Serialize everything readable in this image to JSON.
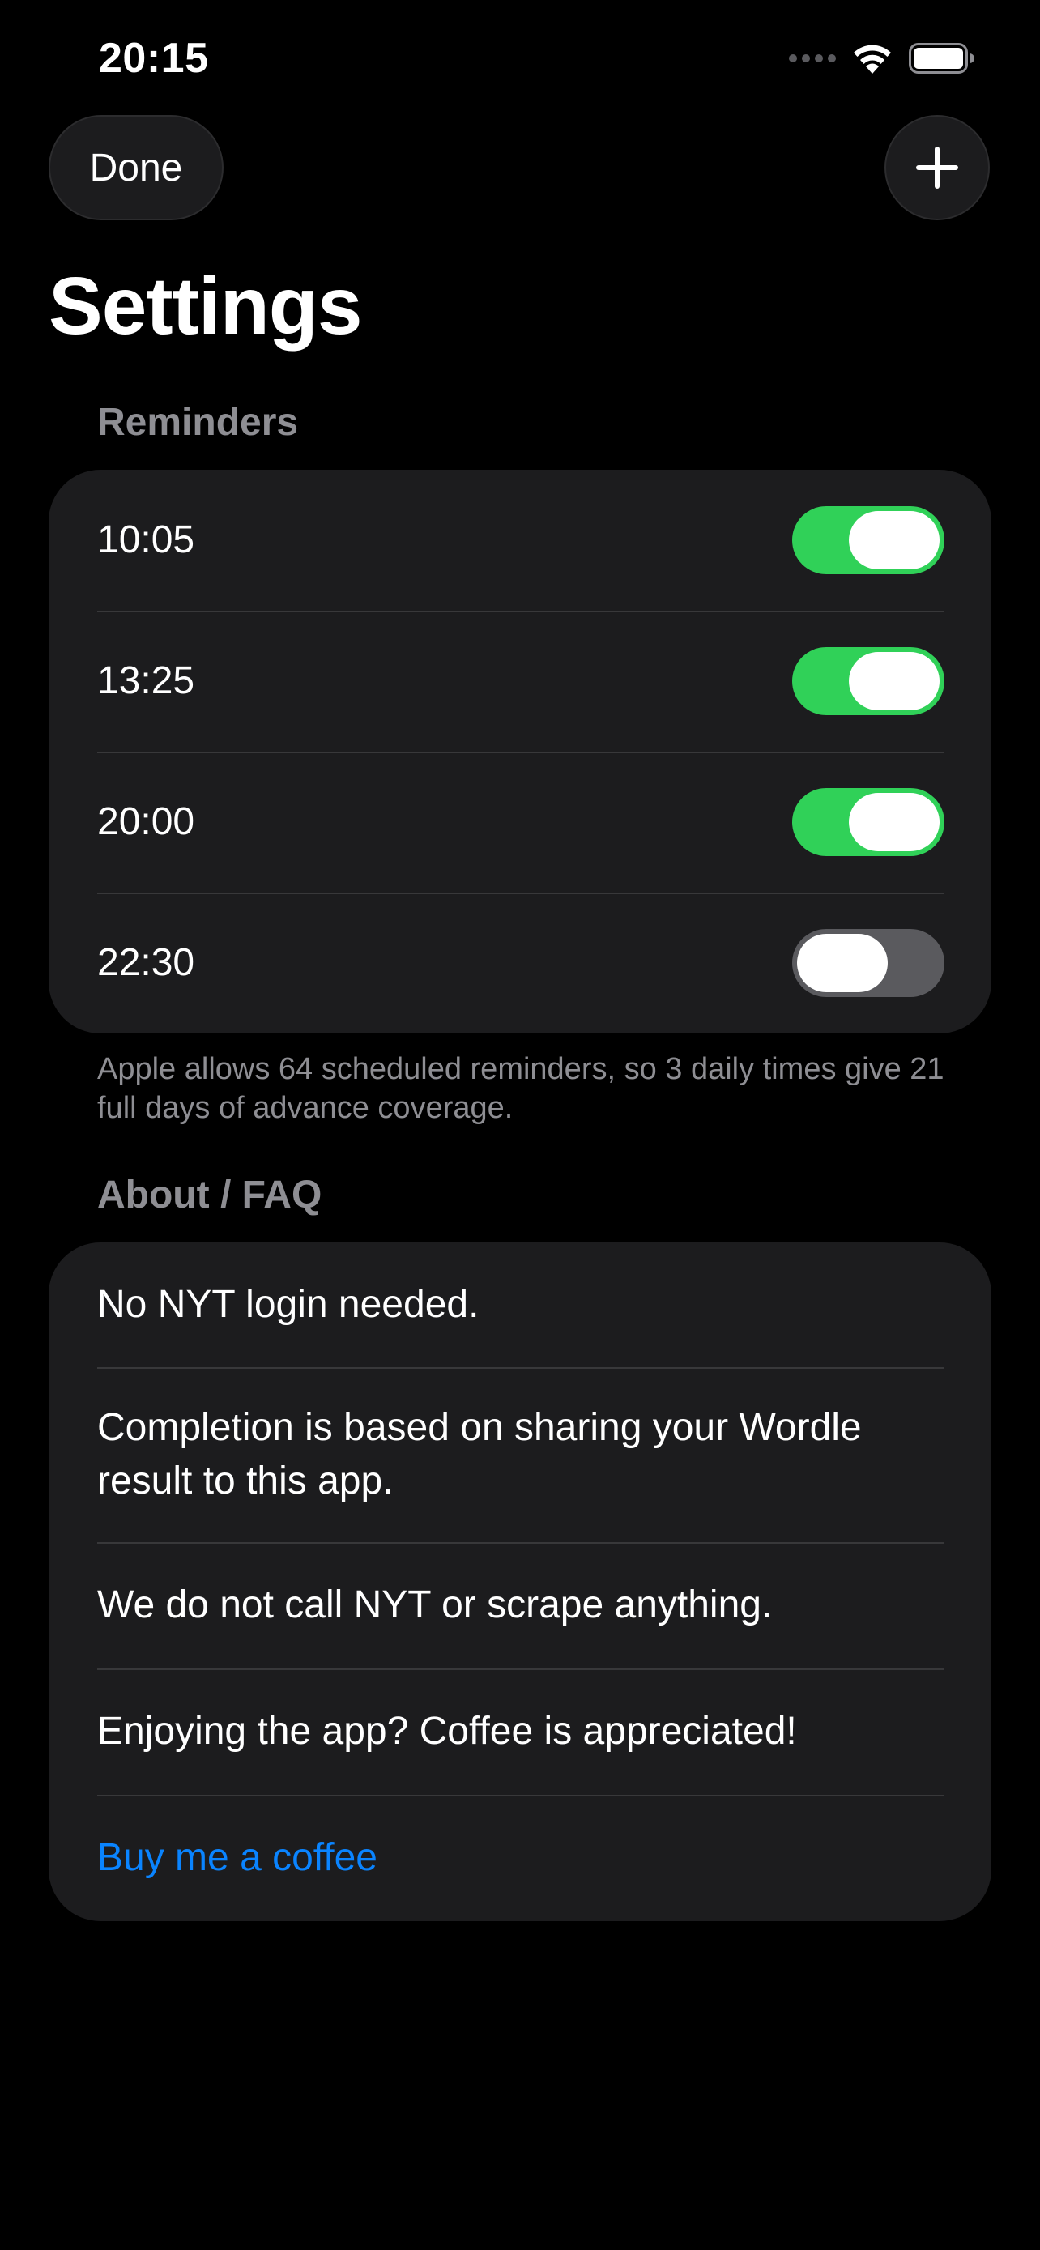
{
  "status_bar": {
    "time": "20:15"
  },
  "nav": {
    "done_label": "Done",
    "add_icon": "plus-icon"
  },
  "title": "Settings",
  "reminders": {
    "header": "Reminders",
    "items": [
      {
        "time": "10:05",
        "enabled": true
      },
      {
        "time": "13:25",
        "enabled": true
      },
      {
        "time": "20:00",
        "enabled": true
      },
      {
        "time": "22:30",
        "enabled": false
      }
    ],
    "footnote": "Apple allows 64 scheduled reminders, so 3 daily times give 21 full days of advance coverage."
  },
  "faq": {
    "header": "About / FAQ",
    "items": [
      "No NYT login needed.",
      "Completion is based on sharing your Wordle result to this app.",
      "We do not call NYT or scrape anything.",
      "Enjoying the app? Coffee is appreciated!"
    ],
    "link_label": "Buy me a coffee"
  },
  "colors": {
    "background": "#000000",
    "card": "#1c1c1e",
    "toggle_on": "#30d158",
    "toggle_off": "#5a5a5e",
    "link": "#0a84ff",
    "secondary_text": "#8e8e93"
  }
}
